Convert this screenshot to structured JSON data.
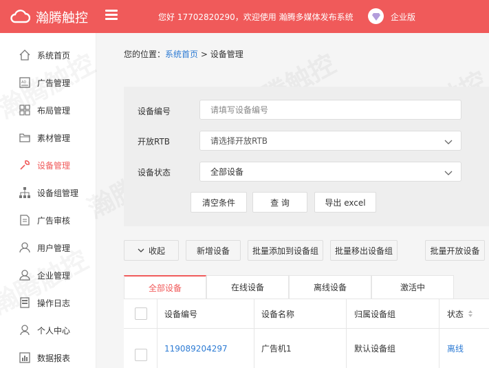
{
  "app": {
    "name": "瀚腾触控"
  },
  "header": {
    "welcome": "您好   17702820290，欢迎使用 瀚腾多媒体发布系统",
    "edition": "企业版"
  },
  "sidebar": {
    "items": [
      {
        "label": "系统首页",
        "icon": "home-icon"
      },
      {
        "label": "广告管理",
        "icon": "ad-icon"
      },
      {
        "label": "布局管理",
        "icon": "grid-icon"
      },
      {
        "label": "素材管理",
        "icon": "folder-icon"
      },
      {
        "label": "设备管理",
        "icon": "wrench-icon",
        "active": true
      },
      {
        "label": "设备组管理",
        "icon": "org-tree-icon"
      },
      {
        "label": "广告审核",
        "icon": "document-icon"
      },
      {
        "label": "用户管理",
        "icon": "users-icon"
      },
      {
        "label": "企业管理",
        "icon": "enterprise-icon"
      },
      {
        "label": "操作日志",
        "icon": "log-icon"
      },
      {
        "label": "个人中心",
        "icon": "user-icon"
      },
      {
        "label": "数据报表",
        "icon": "chart-icon"
      }
    ]
  },
  "breadcrumb": {
    "prefix": "您的位置：",
    "home": "系统首页",
    "separator": ">",
    "current": "设备管理"
  },
  "filters": {
    "device_code": {
      "label": "设备编号",
      "placeholder": "请填写设备编号"
    },
    "open_rtb": {
      "label": "开放RTB",
      "value": "请选择开放RTB"
    },
    "device_status": {
      "label": "设备状态",
      "value": "全部设备"
    },
    "clear_label": "清空条件",
    "query_label": "查 询",
    "export_label": "导出 excel"
  },
  "toolbar": {
    "collapse_label": "收起",
    "add_label": "新增设备",
    "batch_add_group_label": "批量添加到设备组",
    "batch_remove_group_label": "批量移出设备组",
    "batch_open_label": "批量开放设备"
  },
  "tabs": [
    {
      "label": "全部设备",
      "active": true
    },
    {
      "label": "在线设备"
    },
    {
      "label": "离线设备"
    },
    {
      "label": "激活中"
    }
  ],
  "table": {
    "headers": [
      "设备编号",
      "设备名称",
      "归属设备组",
      "状态"
    ],
    "rows": [
      {
        "code": "119089204297",
        "name": "广告机1",
        "group": "默认设备组",
        "status": "离线"
      }
    ]
  },
  "watermark": "瀚腾触控",
  "colors": {
    "brand": "#f05a5a",
    "link": "#2d7bd4"
  }
}
